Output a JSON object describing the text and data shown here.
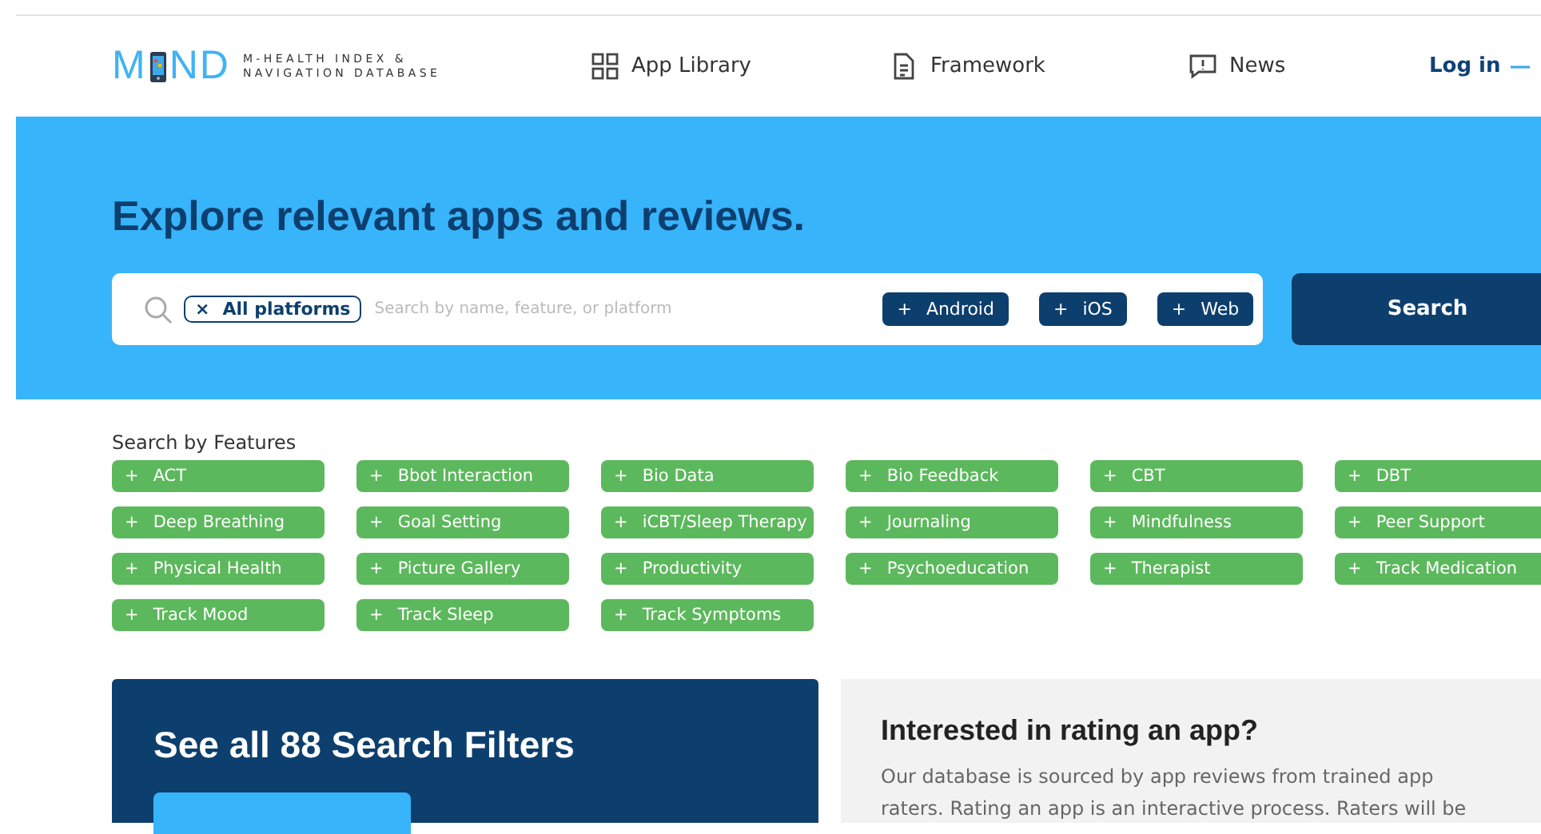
{
  "logo": {
    "left": "M",
    "right": "ND",
    "tagline": [
      "M-HEALTH INDEX &",
      "NAVIGATION DATABASE"
    ]
  },
  "nav": [
    {
      "label": "App Library"
    },
    {
      "label": "Framework"
    },
    {
      "label": "News"
    }
  ],
  "login": {
    "label": "Log in"
  },
  "hero": {
    "title": "Explore relevant apps and reviews.",
    "chip": {
      "label": "All platforms",
      "icon": "×"
    },
    "placeholder": "Search by name, feature, or platform",
    "platforms": [
      {
        "label": "Android",
        "icon": "+"
      },
      {
        "label": "iOS",
        "icon": "+"
      },
      {
        "label": "Web",
        "icon": "+"
      }
    ],
    "search_button": "Search"
  },
  "features": {
    "heading": "Search by Features",
    "items": [
      {
        "label": "ACT",
        "icon": "+"
      },
      {
        "label": "Bbot Interaction",
        "icon": "+"
      },
      {
        "label": "Bio Data",
        "icon": "+"
      },
      {
        "label": "Bio Feedback",
        "icon": "+"
      },
      {
        "label": "CBT",
        "icon": "+"
      },
      {
        "label": "DBT",
        "icon": "+"
      },
      {
        "label": "Deep Breathing",
        "icon": "+"
      },
      {
        "label": "Goal Setting",
        "icon": "+"
      },
      {
        "label": "iCBT/Sleep Therapy",
        "icon": "+"
      },
      {
        "label": "Journaling",
        "icon": "+"
      },
      {
        "label": "Mindfulness",
        "icon": "+"
      },
      {
        "label": "Peer Support",
        "icon": "+"
      },
      {
        "label": "Physical Health",
        "icon": "+"
      },
      {
        "label": "Picture Gallery",
        "icon": "+"
      },
      {
        "label": "Productivity",
        "icon": "+"
      },
      {
        "label": "Psychoeducation",
        "icon": "+"
      },
      {
        "label": "Therapist",
        "icon": "+"
      },
      {
        "label": "Track Medication",
        "icon": "+"
      },
      {
        "label": "Track Mood",
        "icon": "+"
      },
      {
        "label": "Track Sleep",
        "icon": "+"
      },
      {
        "label": "Track Symptoms",
        "icon": "+"
      }
    ]
  },
  "filters_card": {
    "title": "See all 88 Search Filters"
  },
  "rating_card": {
    "title": "Interested in rating an app?",
    "text": "Our database is sourced by app reviews from trained app raters. Rating an app is an interactive process. Raters will be"
  }
}
